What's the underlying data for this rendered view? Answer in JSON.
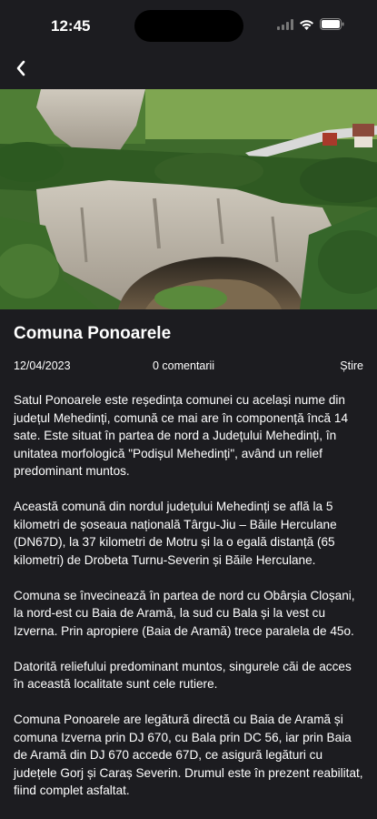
{
  "status_bar": {
    "time": "12:45",
    "icons": [
      "signal-icon",
      "wifi-icon",
      "battery-icon"
    ]
  },
  "nav": {
    "back_icon": "chevron-left-icon"
  },
  "hero": {
    "image": "aerial photo of cave entrance under limestone cliff with forest and village",
    "colors": {
      "sky_green": "#5f8a3c",
      "rock": "#b9b2a6",
      "cave": "#3f3a30"
    }
  },
  "article": {
    "title": "Comuna Ponoarele",
    "date": "12/04/2023",
    "comments": "0 comentarii",
    "category": "Știre",
    "paragraphs": [
      "Satul Ponoarele este reședința comunei cu același nume din județul Mehedinți, comună ce mai are în componență încă 14 sate. Este situat în partea de nord a Județului Mehedinți, în unitatea morfologică \"Podișul Mehedinți\", având un relief predominant muntos.",
      "Această comună din nordul județului Mehedinți se află la 5 kilometri de șoseaua națională Târgu-Jiu – Băile Herculane (DN67D), la 37 kilometri de Motru și la o egală distanță (65 kilometri) de Drobeta Turnu-Severin și Băile Herculane.",
      "Comuna se învecinează în partea de nord cu Obârșia Cloșani, la nord-est cu Baia de Aramă, la sud cu Bala și la vest cu Izverna. Prin apropiere (Baia de Aramă) trece paralela de 45o.",
      "Datorită reliefului predominant muntos, singurele căi de acces în această localitate sunt cele rutiere.",
      "Comuna Ponoarele are legătură directă cu Baia de Aramă și comuna Izverna prin DJ 670, cu Bala prin DC 56, iar prin Baia de Aramă din DJ 670 accede 67D, ce asigură legături cu județele Gorj și Caraș Severin. Drumul este în prezent reabilitat, fiind complet asfaltat."
    ]
  },
  "colors": {
    "background": "#1c1c20",
    "text": "#ffffff"
  }
}
